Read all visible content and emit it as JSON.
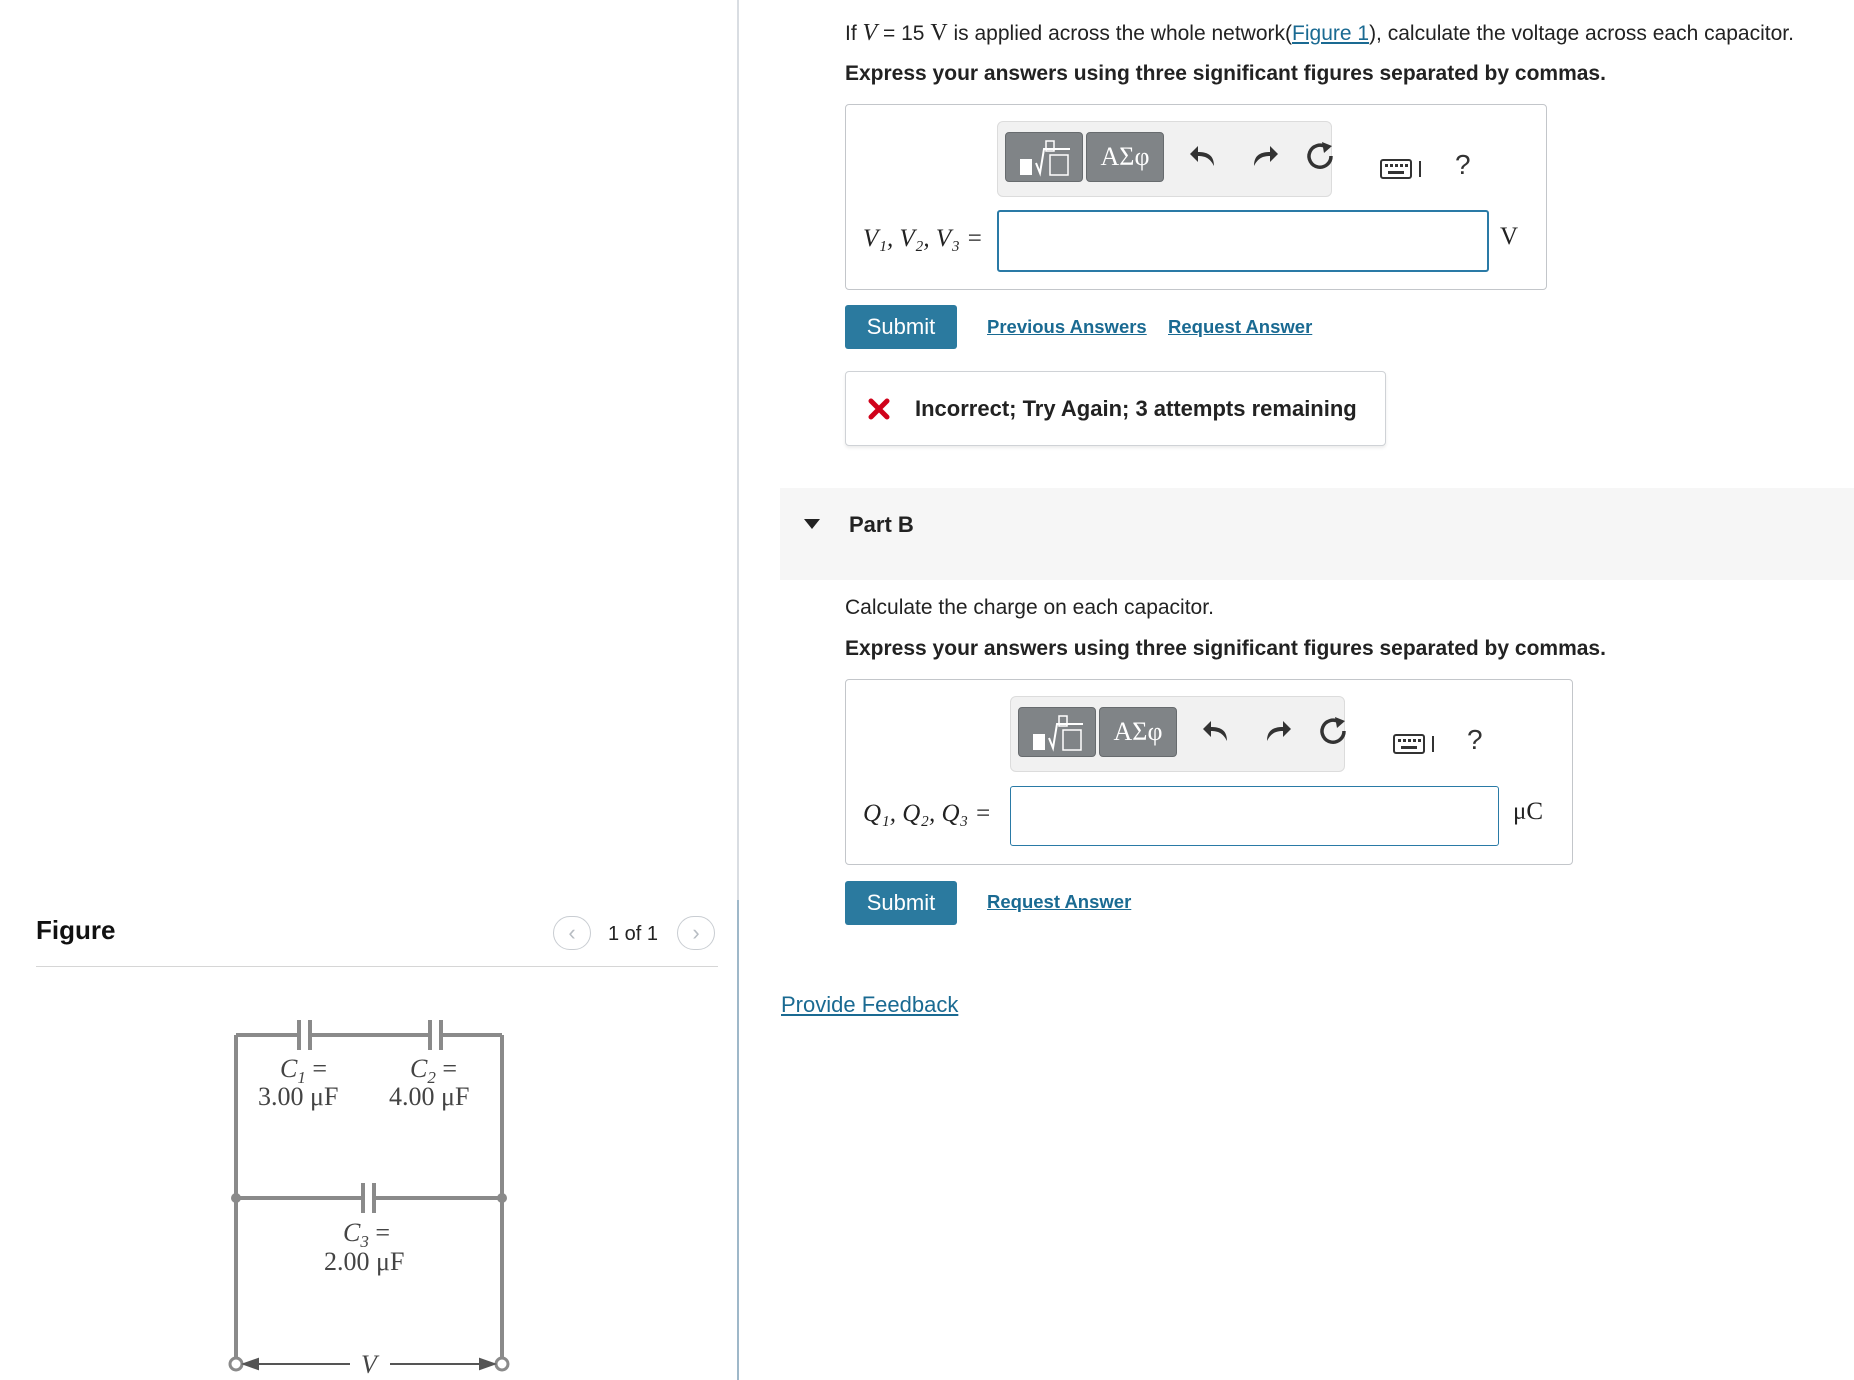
{
  "figure_panel": {
    "title": "Figure",
    "pager": {
      "prev_icon": "chevron-left-icon",
      "count": "1 of 1",
      "next_icon": "chevron-right-icon"
    },
    "circuit": {
      "c1_name": "C",
      "c1_sub": "1",
      "c1_eq": " =",
      "c1_value": "3.00 μF",
      "c2_name": "C",
      "c2_sub": "2",
      "c2_eq": " =",
      "c2_value": "4.00 μF",
      "c3_name": "C",
      "c3_sub": "3",
      "c3_eq": " =",
      "c3_value": "2.00 μF",
      "source_label": "V"
    }
  },
  "part_a": {
    "prompt_pre": "If ",
    "prompt_var": "V",
    "prompt_eq": " = 15 ",
    "prompt_unit": "V",
    "prompt_mid": " is applied across the whole network(",
    "prompt_link": "Figure 1",
    "prompt_post": "), calculate the voltage across each capacitor.",
    "instruction": "Express your answers using three significant figures separated by commas.",
    "toolbar": {
      "templates_icon": "radical-template-icon",
      "greek_label": "ΑΣφ",
      "undo_icon": "undo-icon",
      "redo_icon": "redo-icon",
      "reset_icon": "reset-icon",
      "keyboard_icon": "keyboard-icon",
      "help_label": "?"
    },
    "answer_label": "V₁, V₂, V₃ =",
    "answer_value": "",
    "answer_unit": "V",
    "submit_label": "Submit",
    "previous_answers_label": "Previous Answers",
    "request_answer_label": "Request Answer",
    "feedback": {
      "icon": "x-mark-icon",
      "text": "Incorrect; Try Again; 3 attempts remaining",
      "color": "#d0021b"
    }
  },
  "part_b": {
    "toggle_icon": "caret-down-icon",
    "title": "Part B",
    "prompt": "Calculate the charge on each capacitor.",
    "instruction": "Express your answers using three significant figures separated by commas.",
    "toolbar": {
      "templates_icon": "radical-template-icon",
      "greek_label": "ΑΣφ",
      "undo_icon": "undo-icon",
      "redo_icon": "redo-icon",
      "reset_icon": "reset-icon",
      "keyboard_icon": "keyboard-icon",
      "help_label": "?"
    },
    "answer_label": "Q₁, Q₂, Q₃ =",
    "answer_value": "",
    "answer_unit": "μC",
    "submit_label": "Submit",
    "request_answer_label": "Request Answer"
  },
  "provide_feedback_label": "Provide Feedback",
  "colors": {
    "accent": "#2b7a9f",
    "link": "#1a6a92",
    "error": "#d0021b",
    "input_border": "#2a7aa6"
  }
}
